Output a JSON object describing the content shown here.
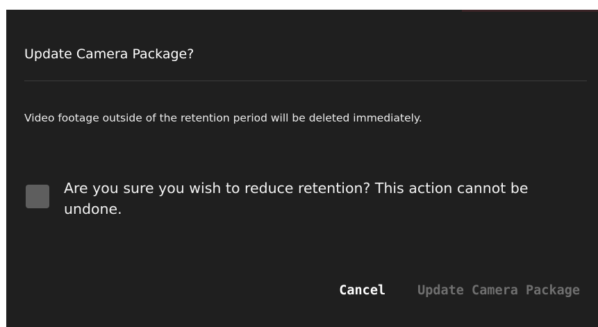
{
  "dialog": {
    "title": "Update Camera Package?",
    "message": "Video footage outside of the retention period will be deleted immediately.",
    "confirm": {
      "checked": false,
      "label": "Are you sure you wish to reduce retention? This action cannot be undone."
    },
    "buttons": {
      "cancel_label": "Cancel",
      "update_label": "Update Camera Package",
      "update_enabled": false
    }
  },
  "colors": {
    "background": "#1f1f1f",
    "text": "#ffffff",
    "divider": "#3c3c3c",
    "checkbox": "#5e5e5e",
    "disabled_text": "#6f6f6f"
  }
}
